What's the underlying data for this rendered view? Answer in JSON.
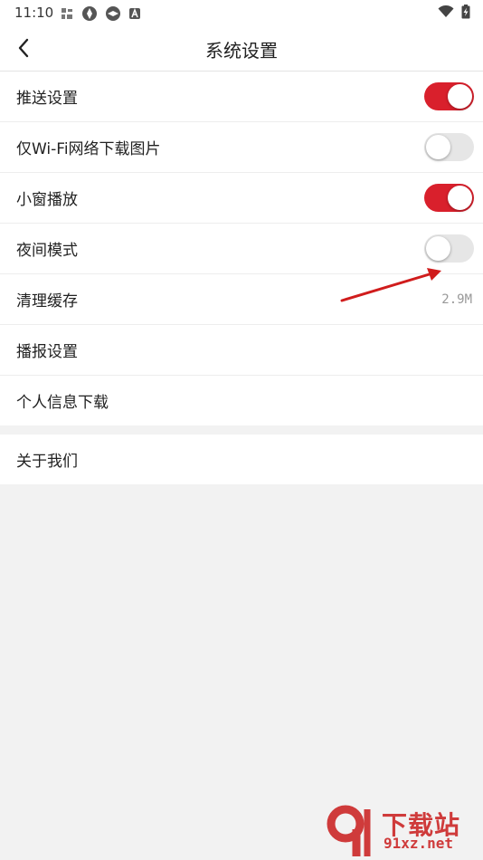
{
  "status_bar": {
    "time": "11:10"
  },
  "header": {
    "title": "系统设置"
  },
  "settings": {
    "push": {
      "label": "推送设置",
      "enabled": true
    },
    "wifi_only": {
      "label": "仅Wi-Fi网络下载图片",
      "enabled": false
    },
    "mini_window": {
      "label": "小窗播放",
      "enabled": true
    },
    "night_mode": {
      "label": "夜间模式",
      "enabled": false
    },
    "clear_cache": {
      "label": "清理缓存",
      "value": "2.9M"
    },
    "broadcast": {
      "label": "播报设置"
    },
    "personal_info": {
      "label": "个人信息下载"
    }
  },
  "about": {
    "label": "关于我们"
  },
  "watermark": {
    "line1": "下载站",
    "line2": "91xz.net"
  },
  "colors": {
    "accent": "#d9202c",
    "toggle_off": "#e6e6e6",
    "background": "#f2f2f2"
  }
}
